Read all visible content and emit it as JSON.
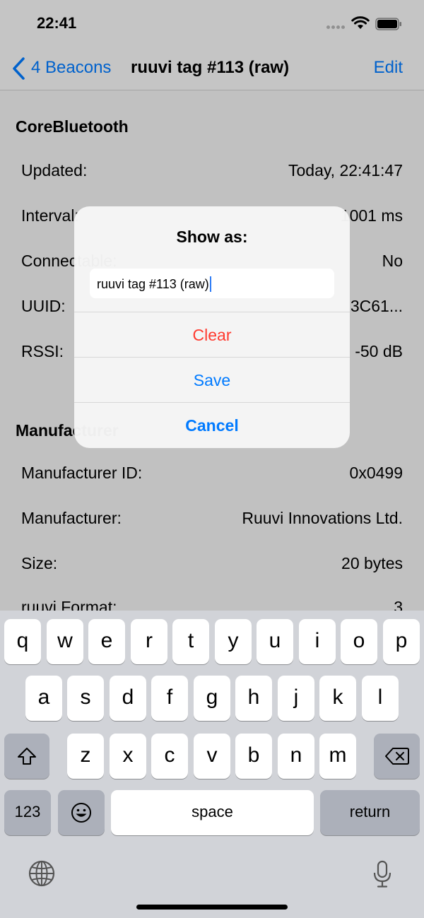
{
  "status_bar": {
    "time": "22:41"
  },
  "navbar": {
    "back_label": "4 Beacons",
    "title": "ruuvi tag #113 (raw)",
    "edit_label": "Edit"
  },
  "sections": {
    "corebluetooth": {
      "header": "CoreBluetooth",
      "rows": [
        {
          "label": "Updated:",
          "value": "Today, 22:41:47"
        },
        {
          "label": "Interval:",
          "value": "1001 ms"
        },
        {
          "label": "Connectable:",
          "value": "No"
        },
        {
          "label": "UUID:",
          "value": "3C61..."
        },
        {
          "label": "RSSI:",
          "value": "-50 dB"
        }
      ]
    },
    "manufacturer": {
      "header": "Manufacturer",
      "rows": [
        {
          "label": "Manufacturer ID:",
          "value": "0x0499"
        },
        {
          "label": "Manufacturer:",
          "value": "Ruuvi Innovations Ltd."
        },
        {
          "label": "Size:",
          "value": "20 bytes"
        },
        {
          "label": "ruuvi Format:",
          "value": "3"
        }
      ]
    }
  },
  "alert": {
    "title": "Show as:",
    "field_value": "ruuvi tag #113 (raw)",
    "clear_label": "Clear",
    "save_label": "Save",
    "cancel_label": "Cancel"
  },
  "keyboard": {
    "row1": [
      "q",
      "w",
      "e",
      "r",
      "t",
      "y",
      "u",
      "i",
      "o",
      "p"
    ],
    "row2": [
      "a",
      "s",
      "d",
      "f",
      "g",
      "h",
      "j",
      "k",
      "l"
    ],
    "row3": [
      "z",
      "x",
      "c",
      "v",
      "b",
      "n",
      "m"
    ],
    "numbers_label": "123",
    "space_label": "space",
    "return_label": "return",
    "shift_icon": "shift-icon",
    "delete_icon": "delete-icon",
    "emoji_icon": "emoji-icon",
    "globe_icon": "globe-icon",
    "mic_icon": "microphone-icon"
  },
  "colors": {
    "accent": "#007aff",
    "destructive": "#ff3b30",
    "keyboard_bg": "#d1d3d8"
  }
}
